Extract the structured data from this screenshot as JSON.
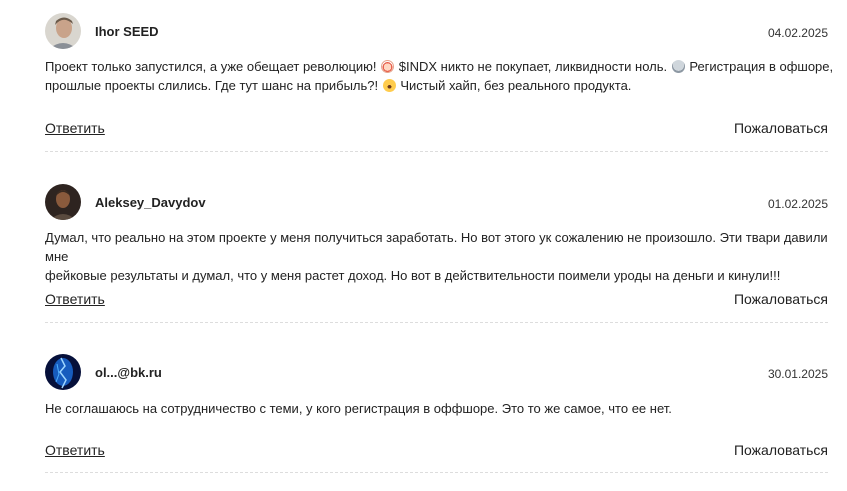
{
  "comments": [
    {
      "author": "Ihor SEED",
      "date": "04.02.2025",
      "text_parts": [
        "Проект только запустился, а уже обещает революцию! ",
        " $INDX никто не покупает, ликвидности ноль. ",
        " Регистрация в офшоре,",
        "прошлые проекты слились. Где тут шанс на прибыль?! ",
        " Чистый хайп, без реального продукта."
      ],
      "emojis": [
        "clown-emoji",
        "skull-emoji",
        "screaming-face-emoji"
      ],
      "reply_label": "Ответить",
      "report_label": "Пожаловаться"
    },
    {
      "author": "Aleksey_Davydov",
      "date": "01.02.2025",
      "text_lines": [
        "Думал, что реально на этом проекте у меня получиться заработать. Но вот этого ук сожалению не произошло. Эти твари давили мне",
        "фейковые результаты и думал, что у меня растет доход. Но вот в действительности поимели уроды на деньги и кинули!!!"
      ],
      "reply_label": "Ответить",
      "report_label": "Пожаловаться"
    },
    {
      "author": "ol...@bk.ru",
      "date": "30.01.2025",
      "text": "Не соглашаюсь на сотрудничество с теми, у кого регистрация в оффшоре. Это то же самое, что ее нет.",
      "reply_label": "Ответить",
      "report_label": "Пожаловаться"
    }
  ]
}
